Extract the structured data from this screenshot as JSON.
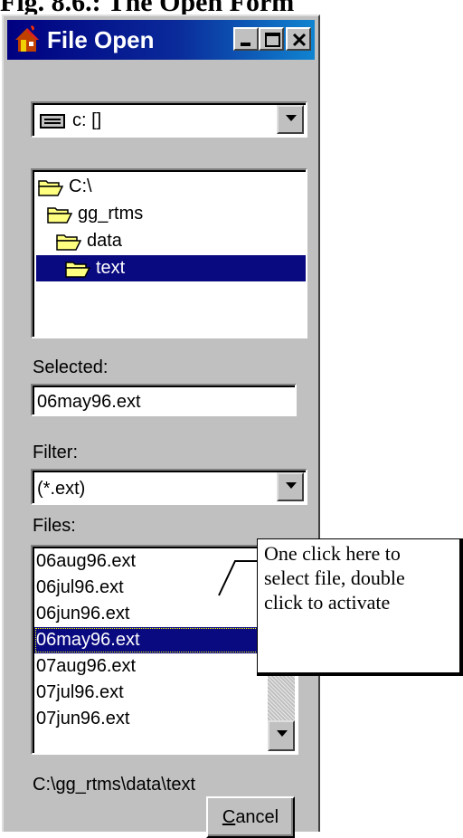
{
  "doc_title": "Fig. 8.6.: The Open Form",
  "window": {
    "title": "File Open",
    "minimize_label": "minimize",
    "maximize_label": "maximize",
    "close_label": "close"
  },
  "drive": {
    "selected": "c: []"
  },
  "directories": [
    {
      "label": "C:\\",
      "selected": false
    },
    {
      "label": "gg_rtms",
      "selected": false
    },
    {
      "label": "data",
      "selected": false
    },
    {
      "label": "text",
      "selected": true
    }
  ],
  "selected_field": {
    "label": "Selected:",
    "value": "06may96.ext"
  },
  "filter": {
    "label": "Filter:",
    "value": "(*.ext)"
  },
  "files": {
    "label": "Files:",
    "items": [
      "06aug96.ext",
      "06jul96.ext",
      "06jun96.ext",
      "06may96.ext",
      "07aug96.ext",
      "07jul96.ext",
      "07jun96.ext"
    ],
    "selected_index": 3
  },
  "path": "C:\\gg_rtms\\data\\text",
  "cancel": {
    "label_underline": "C",
    "label_rest": "ancel"
  },
  "callout": {
    "line1": "One click here to",
    "line2": "select file, double",
    "line3": "click to activate"
  }
}
